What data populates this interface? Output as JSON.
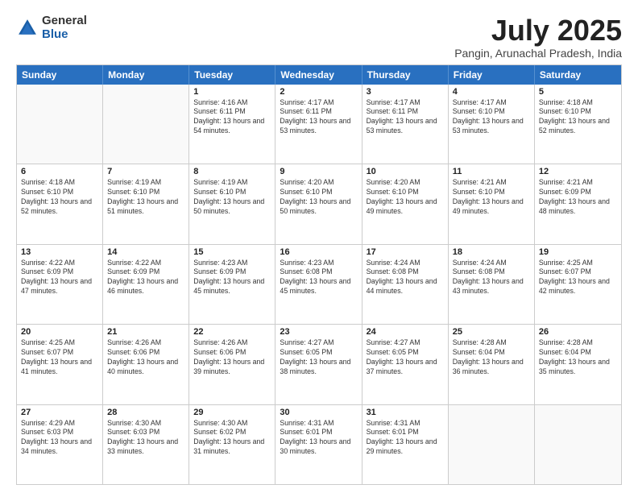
{
  "logo": {
    "general": "General",
    "blue": "Blue"
  },
  "title": "July 2025",
  "subtitle": "Pangin, Arunachal Pradesh, India",
  "header_days": [
    "Sunday",
    "Monday",
    "Tuesday",
    "Wednesday",
    "Thursday",
    "Friday",
    "Saturday"
  ],
  "weeks": [
    [
      {
        "day": "",
        "info": ""
      },
      {
        "day": "",
        "info": ""
      },
      {
        "day": "1",
        "info": "Sunrise: 4:16 AM\nSunset: 6:11 PM\nDaylight: 13 hours and 54 minutes."
      },
      {
        "day": "2",
        "info": "Sunrise: 4:17 AM\nSunset: 6:11 PM\nDaylight: 13 hours and 53 minutes."
      },
      {
        "day": "3",
        "info": "Sunrise: 4:17 AM\nSunset: 6:11 PM\nDaylight: 13 hours and 53 minutes."
      },
      {
        "day": "4",
        "info": "Sunrise: 4:17 AM\nSunset: 6:10 PM\nDaylight: 13 hours and 53 minutes."
      },
      {
        "day": "5",
        "info": "Sunrise: 4:18 AM\nSunset: 6:10 PM\nDaylight: 13 hours and 52 minutes."
      }
    ],
    [
      {
        "day": "6",
        "info": "Sunrise: 4:18 AM\nSunset: 6:10 PM\nDaylight: 13 hours and 52 minutes."
      },
      {
        "day": "7",
        "info": "Sunrise: 4:19 AM\nSunset: 6:10 PM\nDaylight: 13 hours and 51 minutes."
      },
      {
        "day": "8",
        "info": "Sunrise: 4:19 AM\nSunset: 6:10 PM\nDaylight: 13 hours and 50 minutes."
      },
      {
        "day": "9",
        "info": "Sunrise: 4:20 AM\nSunset: 6:10 PM\nDaylight: 13 hours and 50 minutes."
      },
      {
        "day": "10",
        "info": "Sunrise: 4:20 AM\nSunset: 6:10 PM\nDaylight: 13 hours and 49 minutes."
      },
      {
        "day": "11",
        "info": "Sunrise: 4:21 AM\nSunset: 6:10 PM\nDaylight: 13 hours and 49 minutes."
      },
      {
        "day": "12",
        "info": "Sunrise: 4:21 AM\nSunset: 6:09 PM\nDaylight: 13 hours and 48 minutes."
      }
    ],
    [
      {
        "day": "13",
        "info": "Sunrise: 4:22 AM\nSunset: 6:09 PM\nDaylight: 13 hours and 47 minutes."
      },
      {
        "day": "14",
        "info": "Sunrise: 4:22 AM\nSunset: 6:09 PM\nDaylight: 13 hours and 46 minutes."
      },
      {
        "day": "15",
        "info": "Sunrise: 4:23 AM\nSunset: 6:09 PM\nDaylight: 13 hours and 45 minutes."
      },
      {
        "day": "16",
        "info": "Sunrise: 4:23 AM\nSunset: 6:08 PM\nDaylight: 13 hours and 45 minutes."
      },
      {
        "day": "17",
        "info": "Sunrise: 4:24 AM\nSunset: 6:08 PM\nDaylight: 13 hours and 44 minutes."
      },
      {
        "day": "18",
        "info": "Sunrise: 4:24 AM\nSunset: 6:08 PM\nDaylight: 13 hours and 43 minutes."
      },
      {
        "day": "19",
        "info": "Sunrise: 4:25 AM\nSunset: 6:07 PM\nDaylight: 13 hours and 42 minutes."
      }
    ],
    [
      {
        "day": "20",
        "info": "Sunrise: 4:25 AM\nSunset: 6:07 PM\nDaylight: 13 hours and 41 minutes."
      },
      {
        "day": "21",
        "info": "Sunrise: 4:26 AM\nSunset: 6:06 PM\nDaylight: 13 hours and 40 minutes."
      },
      {
        "day": "22",
        "info": "Sunrise: 4:26 AM\nSunset: 6:06 PM\nDaylight: 13 hours and 39 minutes."
      },
      {
        "day": "23",
        "info": "Sunrise: 4:27 AM\nSunset: 6:05 PM\nDaylight: 13 hours and 38 minutes."
      },
      {
        "day": "24",
        "info": "Sunrise: 4:27 AM\nSunset: 6:05 PM\nDaylight: 13 hours and 37 minutes."
      },
      {
        "day": "25",
        "info": "Sunrise: 4:28 AM\nSunset: 6:04 PM\nDaylight: 13 hours and 36 minutes."
      },
      {
        "day": "26",
        "info": "Sunrise: 4:28 AM\nSunset: 6:04 PM\nDaylight: 13 hours and 35 minutes."
      }
    ],
    [
      {
        "day": "27",
        "info": "Sunrise: 4:29 AM\nSunset: 6:03 PM\nDaylight: 13 hours and 34 minutes."
      },
      {
        "day": "28",
        "info": "Sunrise: 4:30 AM\nSunset: 6:03 PM\nDaylight: 13 hours and 33 minutes."
      },
      {
        "day": "29",
        "info": "Sunrise: 4:30 AM\nSunset: 6:02 PM\nDaylight: 13 hours and 31 minutes."
      },
      {
        "day": "30",
        "info": "Sunrise: 4:31 AM\nSunset: 6:01 PM\nDaylight: 13 hours and 30 minutes."
      },
      {
        "day": "31",
        "info": "Sunrise: 4:31 AM\nSunset: 6:01 PM\nDaylight: 13 hours and 29 minutes."
      },
      {
        "day": "",
        "info": ""
      },
      {
        "day": "",
        "info": ""
      }
    ]
  ]
}
